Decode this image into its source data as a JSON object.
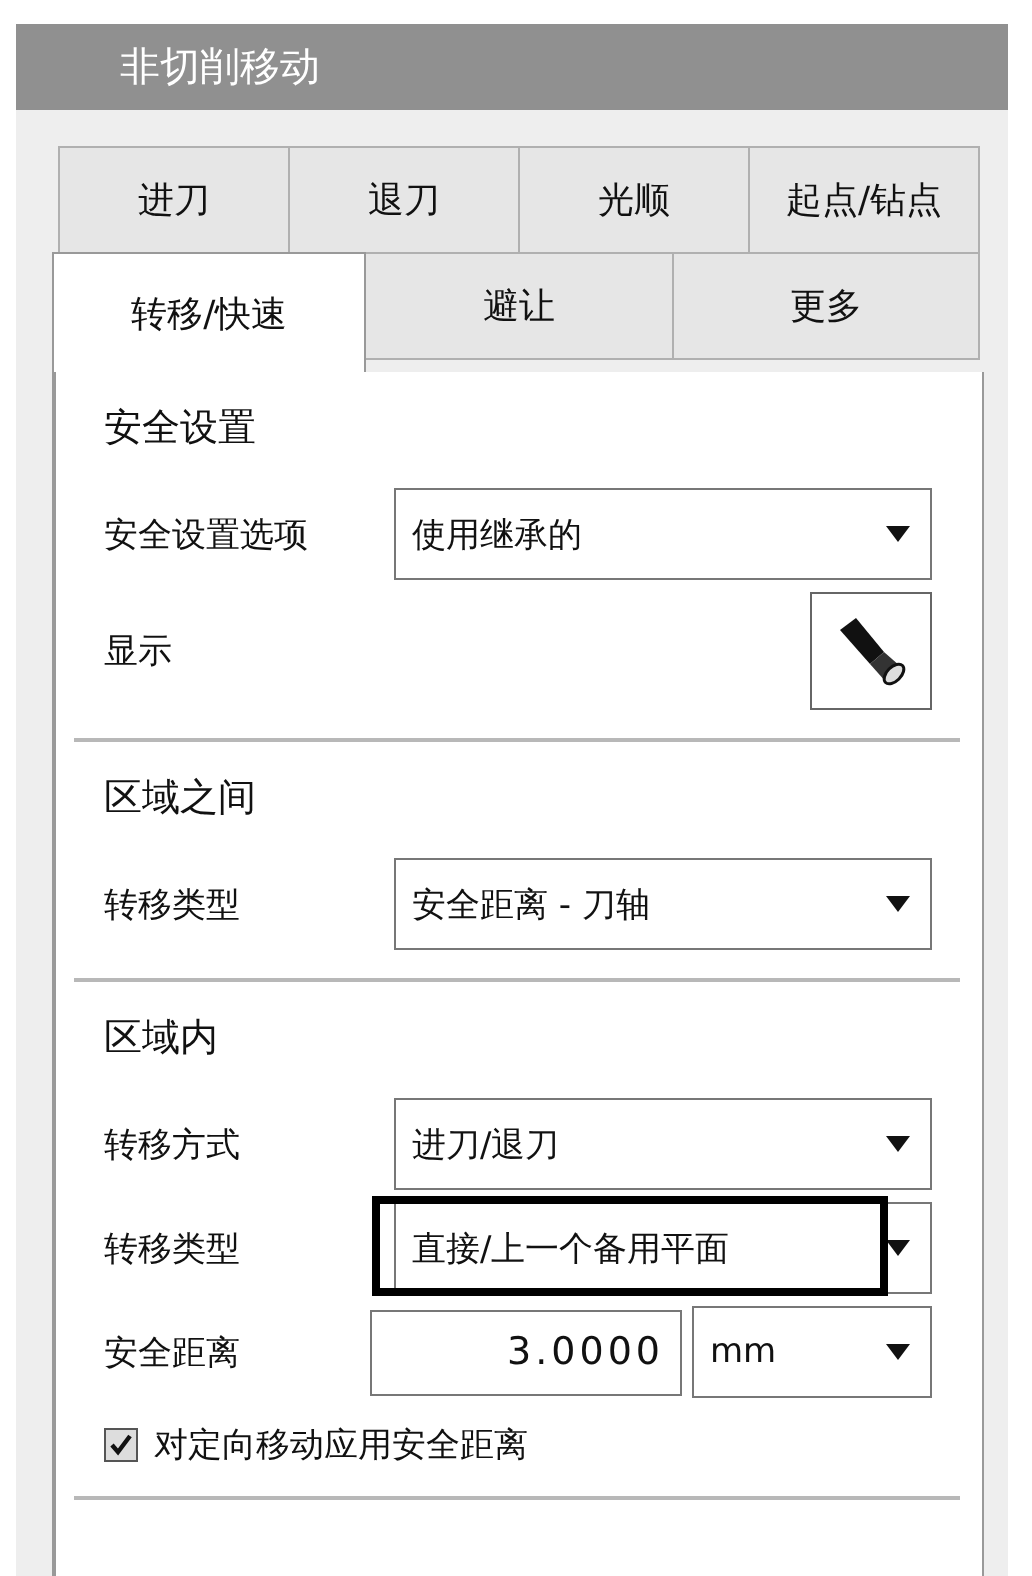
{
  "window": {
    "title": "非切削移动"
  },
  "tab_rows": [
    {
      "tabs": [
        {
          "label": "进刀",
          "selected": false
        },
        {
          "label": "退刀",
          "selected": false
        },
        {
          "label": "光顺",
          "selected": false
        },
        {
          "label": "起点/钻点",
          "selected": false
        }
      ]
    },
    {
      "tabs": [
        {
          "label": "转移/快速",
          "selected": true
        },
        {
          "label": "避让",
          "selected": false
        },
        {
          "label": "更多",
          "selected": false
        }
      ]
    }
  ],
  "sections": [
    {
      "heading": "安全设置",
      "rows": [
        {
          "kind": "dropdown",
          "label": "安全设置选项",
          "value": "使用继承的",
          "highlighted": false
        },
        {
          "kind": "icon_button",
          "label": "显示"
        }
      ]
    },
    {
      "heading": "区域之间",
      "rows": [
        {
          "kind": "dropdown",
          "label": "转移类型",
          "value": "安全距离 - 刀轴",
          "highlighted": false
        }
      ]
    },
    {
      "heading": "区域内",
      "rows": [
        {
          "kind": "dropdown",
          "label": "转移方式",
          "value": "进刀/退刀",
          "highlighted": false
        },
        {
          "kind": "dropdown",
          "label": "转移类型",
          "value": "直接/上一个备用平面",
          "highlighted": true
        },
        {
          "kind": "number_unit",
          "label": "安全距离",
          "value": "3.0000",
          "unit": "mm"
        },
        {
          "kind": "checkbox",
          "label": "对定向移动应用安全距离",
          "checked": true
        }
      ]
    }
  ]
}
